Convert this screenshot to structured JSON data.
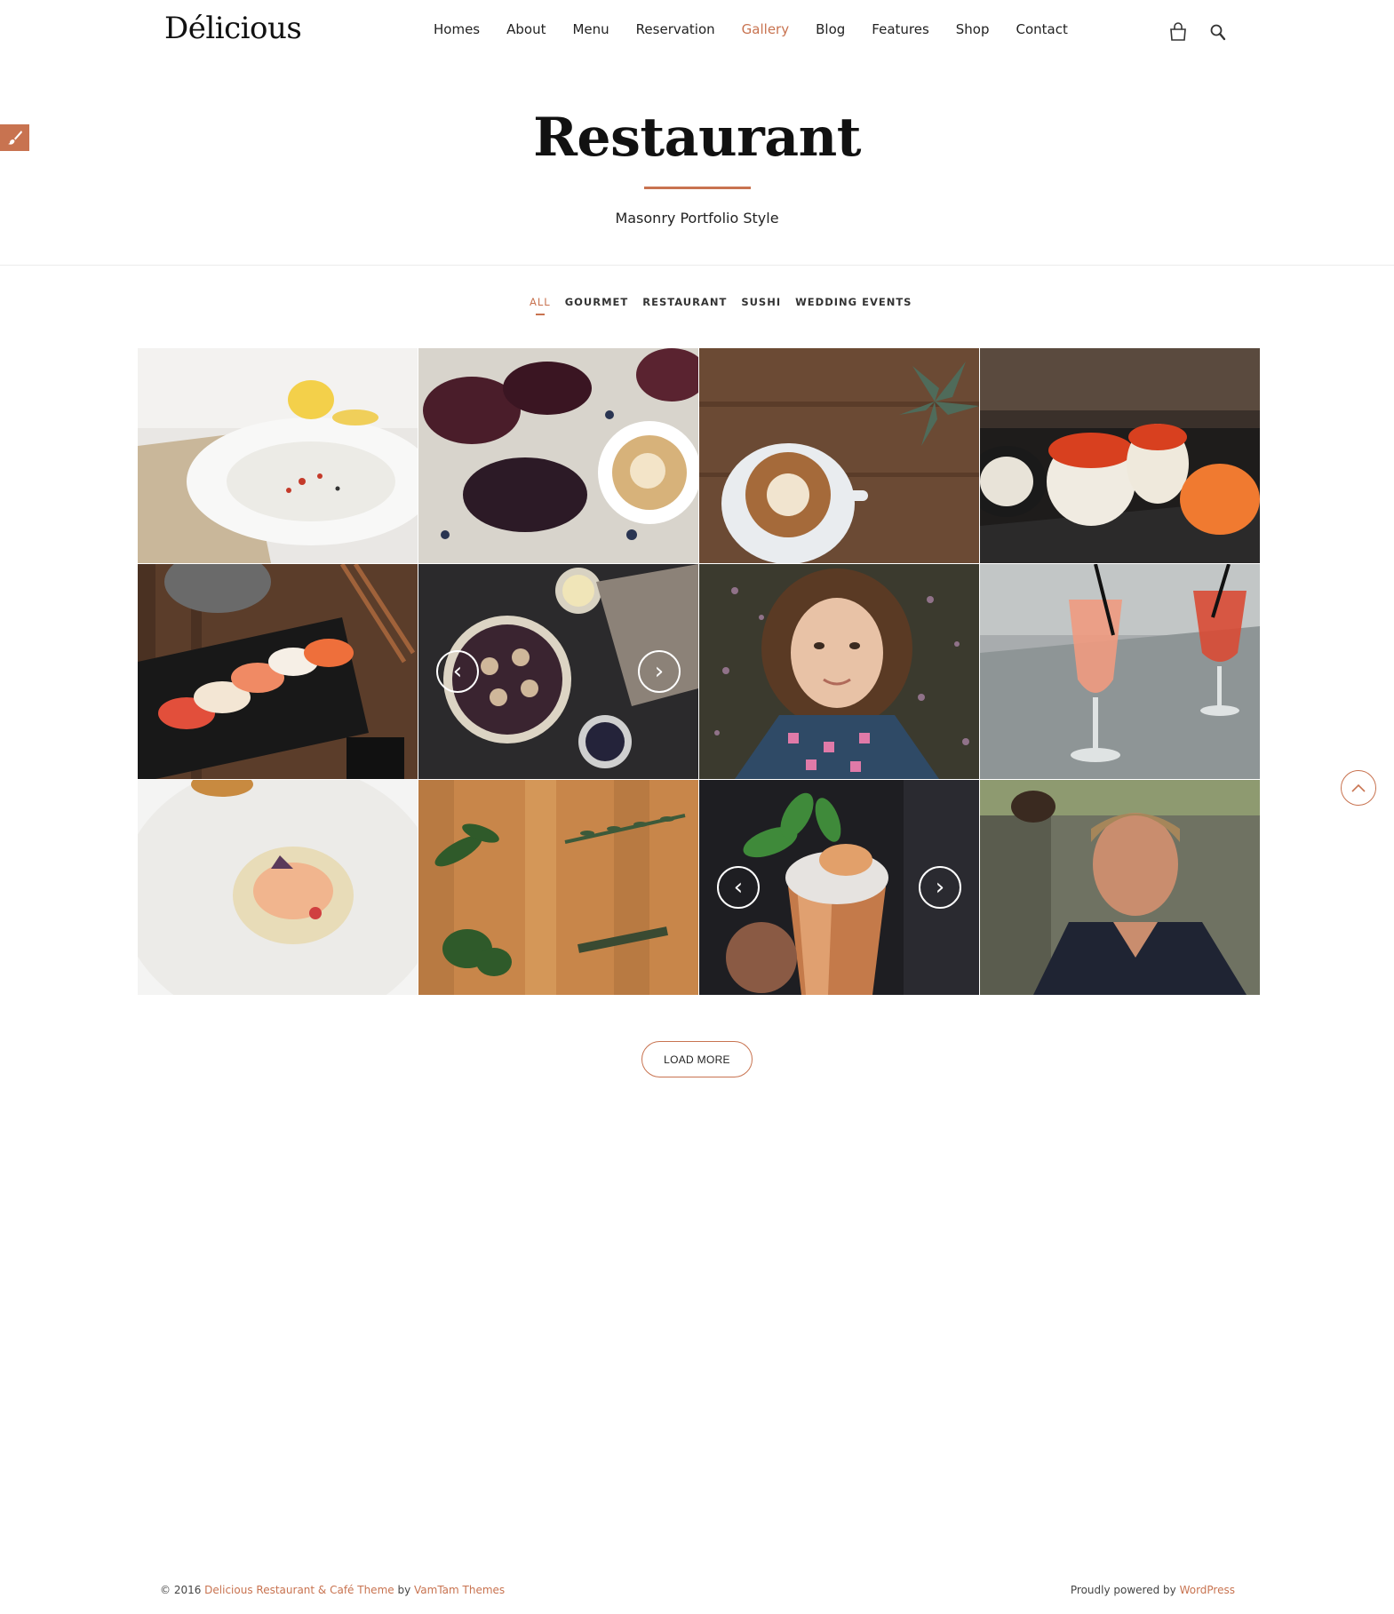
{
  "header": {
    "logo": "Délicious",
    "nav": [
      {
        "label": "Homes",
        "active": false
      },
      {
        "label": "About",
        "active": false
      },
      {
        "label": "Menu",
        "active": false
      },
      {
        "label": "Reservation",
        "active": false
      },
      {
        "label": "Gallery",
        "active": true
      },
      {
        "label": "Blog",
        "active": false
      },
      {
        "label": "Features",
        "active": false
      },
      {
        "label": "Shop",
        "active": false
      },
      {
        "label": "Contact",
        "active": false
      }
    ],
    "icons": {
      "cart": "shopping-bag-icon",
      "search": "search-icon"
    }
  },
  "side_tab": {
    "icon": "paintbrush-icon"
  },
  "hero": {
    "title": "Restaurant",
    "subtitle": "Masonry Portfolio Style"
  },
  "filters": [
    {
      "label": "ALL",
      "active": true
    },
    {
      "label": "GOURMET",
      "active": false
    },
    {
      "label": "RESTAURANT",
      "active": false
    },
    {
      "label": "SUSHI",
      "active": false
    },
    {
      "label": "WEDDING EVENTS",
      "active": false
    }
  ],
  "gallery": {
    "slider_prev_icon": "‹",
    "slider_next_icon": "›"
  },
  "load_more": "LOAD MORE",
  "back_to_top_icon": "chevron-up-icon",
  "footer": {
    "copyright_prefix": "© 2016 ",
    "theme_link": "Delicious Restaurant & Café Theme",
    "by_text": " by ",
    "author_link": "VamTam Themes",
    "powered_prefix": "Proudly powered by ",
    "wordpress_link": "WordPress"
  },
  "colors": {
    "accent": "#c87350",
    "text": "#222222",
    "background": "#ffffff"
  }
}
